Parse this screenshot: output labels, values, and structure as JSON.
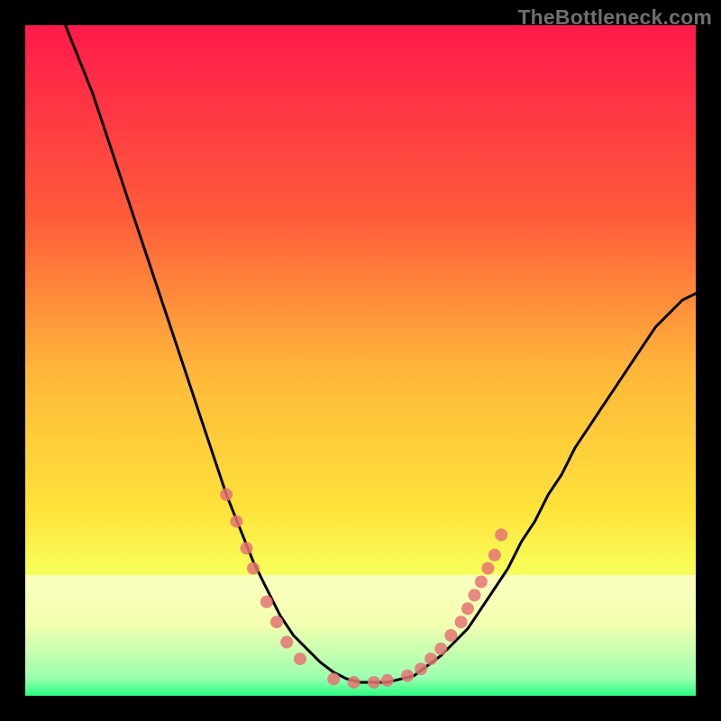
{
  "watermark": "TheBottleneck.com",
  "colors": {
    "gradient_top": "#ff1a4b",
    "gradient_mid1": "#ff8a2a",
    "gradient_mid2": "#ffe23a",
    "gradient_mid3": "#f7ff66",
    "gradient_bottom": "#2bff82",
    "curve": "#000000",
    "markers": "#e57373",
    "frame": "#000000"
  },
  "chart_data": {
    "type": "line",
    "title": "",
    "xlabel": "",
    "ylabel": "",
    "xlim": [
      0,
      100
    ],
    "ylim": [
      0,
      100
    ],
    "series": [
      {
        "name": "bottleneck-curve",
        "x": [
          6,
          8,
          10,
          12,
          14,
          16,
          18,
          20,
          22,
          24,
          26,
          28,
          30,
          32,
          34,
          36,
          38,
          40,
          42,
          44,
          46,
          48,
          50,
          52,
          54,
          56,
          58,
          60,
          62,
          64,
          66,
          68,
          70,
          72,
          74,
          76,
          78,
          80,
          82,
          84,
          86,
          88,
          90,
          92,
          94,
          96,
          98,
          100
        ],
        "values": [
          100,
          95,
          90,
          84,
          78,
          72,
          66,
          60,
          54,
          48,
          42,
          36,
          30,
          25,
          20,
          16,
          12,
          9,
          7,
          5,
          3.5,
          2.5,
          2,
          2,
          2,
          2.5,
          3,
          4.5,
          6,
          8,
          10,
          13,
          16,
          19,
          23,
          26,
          30,
          33,
          37,
          40,
          43,
          46,
          49,
          52,
          55,
          57,
          59,
          60
        ]
      }
    ],
    "markers": [
      {
        "x": 30,
        "y": 30
      },
      {
        "x": 31.5,
        "y": 26
      },
      {
        "x": 33,
        "y": 22
      },
      {
        "x": 34,
        "y": 19
      },
      {
        "x": 36,
        "y": 14
      },
      {
        "x": 37.5,
        "y": 11
      },
      {
        "x": 39,
        "y": 8
      },
      {
        "x": 41,
        "y": 5.5
      },
      {
        "x": 46,
        "y": 2.5
      },
      {
        "x": 49,
        "y": 2
      },
      {
        "x": 52,
        "y": 2
      },
      {
        "x": 54,
        "y": 2.3
      },
      {
        "x": 57,
        "y": 3
      },
      {
        "x": 59,
        "y": 4
      },
      {
        "x": 60.5,
        "y": 5.5
      },
      {
        "x": 62,
        "y": 7
      },
      {
        "x": 63.5,
        "y": 9
      },
      {
        "x": 65,
        "y": 11
      },
      {
        "x": 66,
        "y": 13
      },
      {
        "x": 67,
        "y": 15
      },
      {
        "x": 68,
        "y": 17
      },
      {
        "x": 69,
        "y": 19
      },
      {
        "x": 70,
        "y": 21
      },
      {
        "x": 71,
        "y": 24
      }
    ],
    "band": {
      "y0": 0,
      "y1": 18,
      "note": "pale-yellow-to-green gradient band near bottom"
    }
  }
}
